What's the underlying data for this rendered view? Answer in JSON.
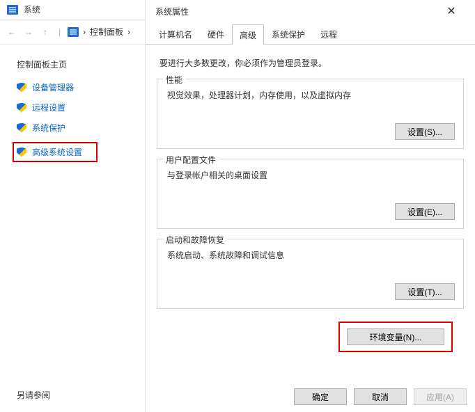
{
  "bg": {
    "app_title": "系统",
    "breadcrumb_label": "控制面板",
    "sidebar": {
      "main": "控制面板主页",
      "items": [
        {
          "label": "设备管理器"
        },
        {
          "label": "远程设置"
        },
        {
          "label": "系统保护"
        },
        {
          "label": "高级系统设置"
        }
      ],
      "also_see": "另请参阅"
    }
  },
  "dlg": {
    "title": "系统属性",
    "tabs": [
      {
        "label": "计算机名"
      },
      {
        "label": "硬件"
      },
      {
        "label": "高级"
      },
      {
        "label": "系统保护"
      },
      {
        "label": "远程"
      }
    ],
    "intro": "要进行大多数更改，你必须作为管理员登录。",
    "groups": {
      "perf": {
        "legend": "性能",
        "desc": "视觉效果，处理器计划，内存使用，以及虚拟内存",
        "btn": "设置(S)..."
      },
      "profile": {
        "legend": "用户配置文件",
        "desc": "与登录帐户相关的桌面设置",
        "btn": "设置(E)..."
      },
      "startup": {
        "legend": "启动和故障恢复",
        "desc": "系统启动、系统故障和调试信息",
        "btn": "设置(T)..."
      }
    },
    "env_btn": "环境变量(N)...",
    "footer": {
      "ok": "确定",
      "cancel": "取消",
      "apply": "应用(A)"
    }
  }
}
